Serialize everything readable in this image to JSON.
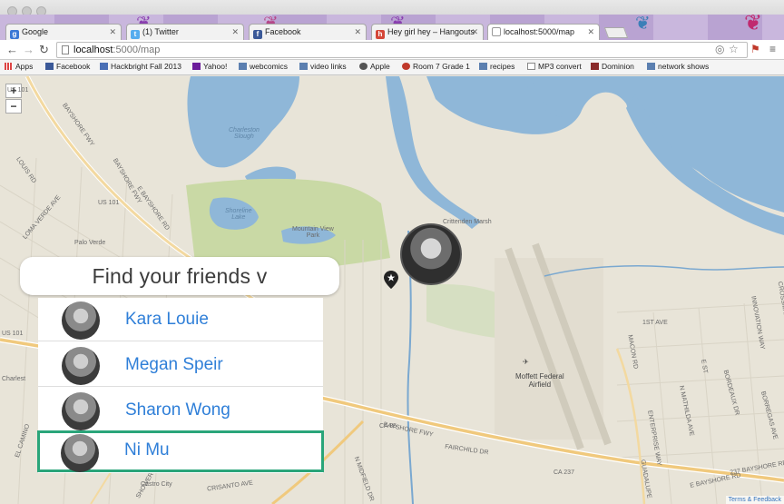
{
  "browser": {
    "tabs": [
      {
        "label": "Google",
        "favicon_color": "#3a78d5",
        "favicon_glyph": "g",
        "active": false
      },
      {
        "label": "(1) Twitter",
        "favicon_color": "#55acee",
        "favicon_glyph": "t",
        "active": false
      },
      {
        "label": "Facebook",
        "favicon_color": "#3b5998",
        "favicon_glyph": "f",
        "active": false
      },
      {
        "label": "Hey girl hey – Hangouts",
        "favicon_color": "#d44638",
        "favicon_glyph": "h",
        "active": false
      },
      {
        "label": "localhost:5000/map",
        "favicon_color": "#ffffff",
        "favicon_glyph": "",
        "active": true
      }
    ],
    "url_host": "localhost",
    "url_path": ":5000/map",
    "bookmarks": [
      {
        "label": "Apps",
        "icon": "apps-grid-icon"
      },
      {
        "label": "Facebook",
        "icon": "facebook-icon"
      },
      {
        "label": "Hackbright Fall 2013",
        "icon": "hackbright-icon"
      },
      {
        "label": "Yahoo!",
        "icon": "yahoo-icon"
      },
      {
        "label": "webcomics",
        "icon": "folder-icon"
      },
      {
        "label": "video links",
        "icon": "folder-icon"
      },
      {
        "label": "Apple",
        "icon": "apple-icon"
      },
      {
        "label": "Room 7 Grade 1",
        "icon": "apple-red-icon"
      },
      {
        "label": "recipes",
        "icon": "folder-icon"
      },
      {
        "label": "MP3 convert",
        "icon": "page-icon"
      },
      {
        "label": "Dominion",
        "icon": "dominion-icon"
      },
      {
        "label": "network shows",
        "icon": "folder-icon"
      }
    ]
  },
  "map": {
    "zoom_in": "+",
    "zoom_out": "−",
    "attribution": "Terms & Feedback",
    "labels": {
      "charleston_slough": "Charleston\nSlough",
      "shoreline_lake": "Shoreline\nLake",
      "mountain_view_park": "Mountain View\nPark",
      "crittenden_marsh": "Crittenden Marsh",
      "moffett": "Moffett Federal\nAirfield",
      "palo_verde": "Palo Verde",
      "castro_city": "Castro City",
      "charleston": "Charlest",
      "us101_a": "US 101",
      "us101_b": "US 101",
      "us101_c": "US 101",
      "bayshore_a": "BAYSHORE FWY",
      "bayshore_b": "BAYSHORE FWY",
      "bayshore_c": "BAYSHORE FWY",
      "e_bayshore": "E BAYSHORE RD",
      "e_bayshore_b": "E BAYSHORE RD",
      "louis_rd": "LOUIS RD",
      "loma_verde": "LOMA VERDE AVE",
      "ca85": "CA 85",
      "fairchild": "FAIRCHILD DR",
      "first_ave": "1ST AVE",
      "enterprise": "ENTERPRISE WAY",
      "mathilda": "N MATHILDA AVE",
      "bordeaux": "BORDEAUX DR",
      "borregas": "BORREGAS AVE",
      "crossman": "CROSSMAN AVE",
      "macon": "MACON RD",
      "e_st": "E ST",
      "innovation": "INNOVATION WAY",
      "e_237": "237 BAYSHORE RD",
      "crisanto": "CRISANTO AVE",
      "showers": "SHOWERS DR",
      "el_camino": "EL CAMINO",
      "ca237": "CA 237",
      "midfield": "N MIDFIELD DR",
      "guadalupe": "GUADALUPE"
    }
  },
  "friends_panel": {
    "title": "Find your friends v",
    "friends": [
      {
        "name": "Kara Louie",
        "selected": false
      },
      {
        "name": "Megan Speir",
        "selected": false
      },
      {
        "name": "Sharon Wong",
        "selected": false
      },
      {
        "name": "Ni Mu",
        "selected": true
      }
    ]
  },
  "colors": {
    "accent_link": "#2f7fd8",
    "selected_border": "#2aa57a",
    "water": "#8fb7d8",
    "park": "#c9d9a5"
  }
}
